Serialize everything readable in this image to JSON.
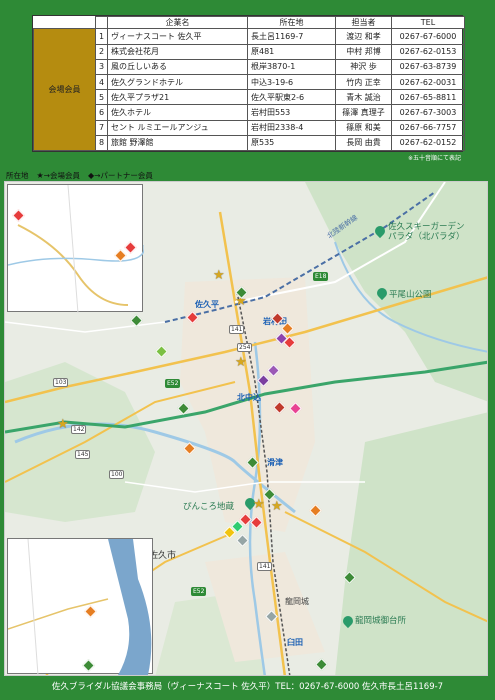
{
  "table": {
    "headers": [
      "企業名",
      "所在地",
      "担当者",
      "TEL"
    ],
    "category": "会場会員",
    "rows": [
      {
        "no": "1",
        "name": "ヴィーナスコート 佐久平",
        "address": "長土呂1169-7",
        "rep": "渡辺 和孝",
        "tel": "0267-67-6000"
      },
      {
        "no": "2",
        "name": "株式会社花月",
        "address": "原481",
        "rep": "中村 邦博",
        "tel": "0267-62-0153"
      },
      {
        "no": "3",
        "name": "風の丘しいある",
        "address": "根岸3870-1",
        "rep": "神沢 歩",
        "tel": "0267-63-8739"
      },
      {
        "no": "4",
        "name": "佐久グランドホテル",
        "address": "中込3-19-6",
        "rep": "竹内 正幸",
        "tel": "0267-62-0031"
      },
      {
        "no": "5",
        "name": "佐久平プラザ21",
        "address": "佐久平駅東2-6",
        "rep": "青木 誠治",
        "tel": "0267-65-8811"
      },
      {
        "no": "6",
        "name": "佐久ホテル",
        "address": "岩村田553",
        "rep": "篠澤 真理子",
        "tel": "0267-67-3003"
      },
      {
        "no": "7",
        "name": "セント ルミエールアンジュ",
        "address": "岩村田2338-4",
        "rep": "篠原 和美",
        "tel": "0267-66-7757"
      },
      {
        "no": "8",
        "name": "旅館 野澤館",
        "address": "原535",
        "rep": "長岡 由貴",
        "tel": "0267-62-0152"
      }
    ],
    "note": "※五十音順にて表記"
  },
  "legend": {
    "prefix": "所在地",
    "member_symbol": "★",
    "member_label": "→会場会員",
    "partner_symbol": "◆",
    "partner_label": "→パートナー会員"
  },
  "map": {
    "labels": {
      "ski": "佐久スキーガーデン\nパラダ（北パラダ）",
      "hirao": "平尾山公園",
      "sakudaira": "佐久平",
      "iwamurada": "岩村田",
      "kitanakagomi": "北中込",
      "takiharu": "滑津",
      "pinkoro": "ぴんころ地蔵",
      "sakushi": "佐久市",
      "tatsuoka": "龍岡城",
      "goryokaku": "龍岡城御台所",
      "usuda": "臼田",
      "shinkansen": "北陸新幹線"
    },
    "shields": [
      "E18",
      "141",
      "142",
      "254",
      "E52",
      "103",
      "145",
      "100",
      "141",
      "E52"
    ]
  },
  "colors": {
    "background": "#2e8a36",
    "category": "#b58c10",
    "star": "#d6a720"
  },
  "footer": "佐久ブライダル協議会事務局（ヴィーナスコート 佐久平）TEL：0267-67-6000 佐久市長土呂1169-7"
}
